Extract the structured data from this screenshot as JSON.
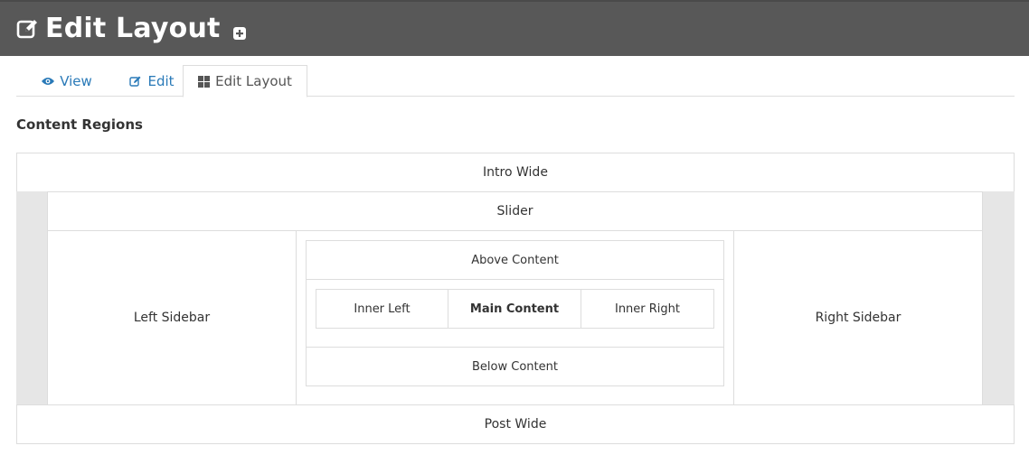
{
  "header": {
    "title": "Edit Layout",
    "title_icon": "edit-icon",
    "add_icon": "plus-square-icon",
    "background": "#585858"
  },
  "tabs": [
    {
      "label": "View",
      "icon": "eye-icon",
      "active": false
    },
    {
      "label": "Edit",
      "icon": "edit-icon",
      "active": false
    },
    {
      "label": "Edit Layout",
      "icon": "grid-icon",
      "active": true
    }
  ],
  "section_title": "Content Regions",
  "regions": {
    "intro_wide": "Intro Wide",
    "slider": "Slider",
    "left_sidebar": "Left Sidebar",
    "above_content": "Above Content",
    "inner_left": "Inner Left",
    "main_content": "Main Content",
    "inner_right": "Inner Right",
    "below_content": "Below Content",
    "right_sidebar": "Right Sidebar",
    "post_wide": "Post Wide"
  },
  "colors": {
    "link": "#2a7ab8",
    "gutter": "#e6e6e6",
    "border": "#dddddd"
  }
}
